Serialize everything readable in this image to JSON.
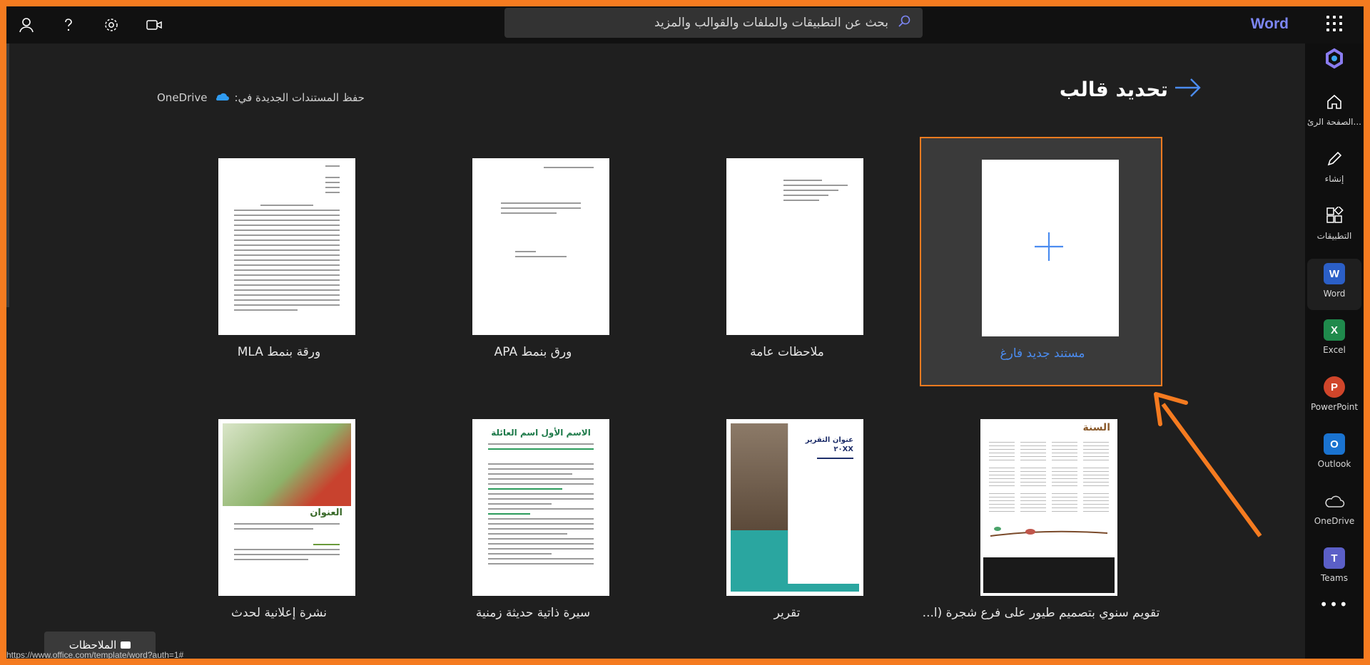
{
  "topbar": {
    "brand": "Word",
    "search_placeholder": "بحث عن التطبيقات والملفات والقوالب والمزيد",
    "icons": [
      "account-icon",
      "help-icon",
      "settings-icon",
      "video-icon",
      "search-icon",
      "app-launcher-icon"
    ]
  },
  "page": {
    "title": "تحديد قالب",
    "save_label": "حفظ المستندات الجديدة في:",
    "save_location": "OneDrive"
  },
  "templates": {
    "blank": "مستند جديد فارغ",
    "notes": "ملاحظات عامة",
    "apa": "ورق بنمط APA",
    "mla": "ورقة بنمط MLA",
    "calendar": "تقويم سنوي بتصميم طيور على فرع شجرة (ا...",
    "report": "تقرير",
    "resume": "سيرة ذاتية حديثة زمنية",
    "flyer": "نشرة إعلانية لحدث"
  },
  "thumbs": {
    "calendar_year": "السنة",
    "report_title": "عنوان التقرير",
    "report_year": "٢٠XX",
    "resume_name": "الاسم الأول اسم العائلة",
    "flyer_title": "العنوان"
  },
  "rail": {
    "home": "الصفحة الرئ...",
    "create": "إنشاء",
    "apps": "التطبيقات",
    "word": "Word",
    "excel": "Excel",
    "powerpoint": "PowerPoint",
    "outlook": "Outlook",
    "onedrive": "OneDrive",
    "teams": "Teams"
  },
  "status": {
    "url": "https://www.office.com/template/word?auth=1#",
    "feedback": "الملاحظات"
  },
  "colors": {
    "accent_orange": "#f57b20",
    "brand": "#7c86f4",
    "link_blue": "#4b8cf0"
  }
}
